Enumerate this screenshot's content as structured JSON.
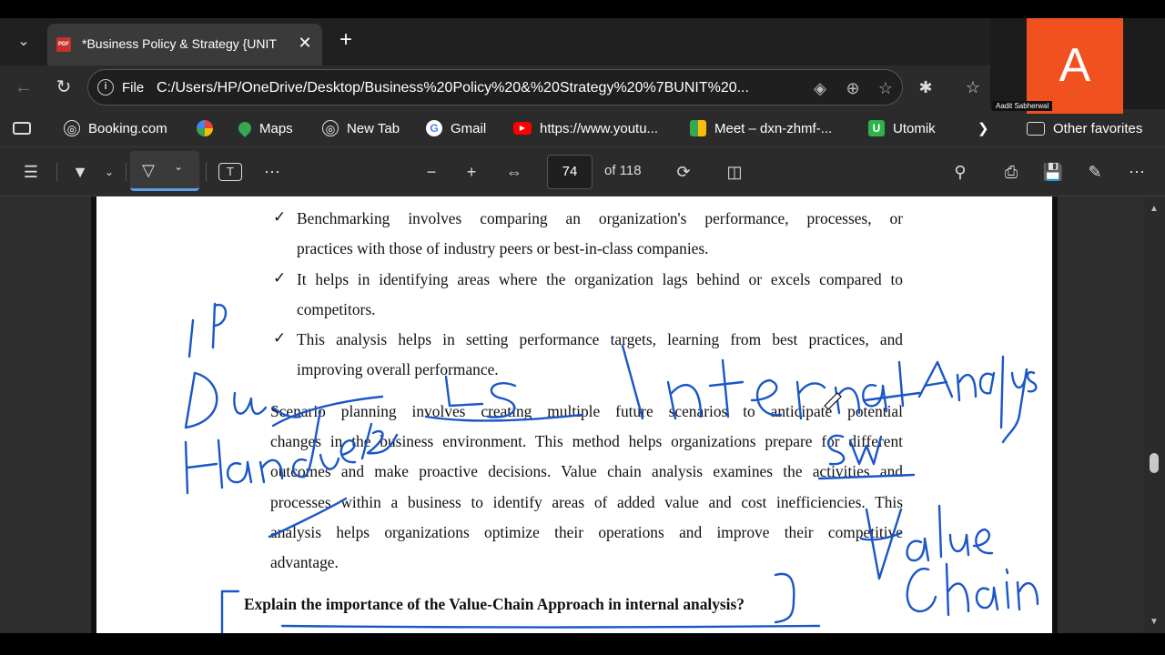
{
  "browser": {
    "tab_title": "*Business Policy & Strategy {UNIT",
    "tab_icon": "pdf-icon",
    "tab_icon_text": "PDF",
    "address_scheme": "File",
    "address_url": "C:/Users/HP/OneDrive/Desktop/Business%20Policy%20&%20Strategy%20%7BUNIT%20..."
  },
  "bookmarks": [
    {
      "label": "Booking.com",
      "icon": "globe-icon"
    },
    {
      "label": "",
      "icon": "google-photos-icon"
    },
    {
      "label": "Maps",
      "icon": "maps-icon"
    },
    {
      "label": "New Tab",
      "icon": "globe-icon"
    },
    {
      "label": "Gmail",
      "icon": "google-icon"
    },
    {
      "label": "https://www.youtu...",
      "icon": "youtube-icon"
    },
    {
      "label": "Meet – dxn-zhmf-...",
      "icon": "meet-icon"
    },
    {
      "label": "Utomik",
      "icon": "utomik-icon"
    }
  ],
  "other_favorites": "Other favorites",
  "pdf_toolbar": {
    "page_number": "74",
    "page_total": "of 118"
  },
  "document": {
    "bullets": [
      [
        "Benchmarking involves comparing an organization's performance, processes, or",
        "practices with those of industry peers or best-in-class companies."
      ],
      [
        "It helps in identifying areas where the organization lags behind or excels compared to",
        "competitors."
      ],
      [
        "This analysis helps in setting performance targets, learning from best practices, and",
        "improving overall performance."
      ]
    ],
    "paragraph": [
      "Scenario planning involves creating multiple future scenarios to anticipate potential",
      "changes in the business environment. This method helps organizations prepare for different",
      "outcomes and make proactive decisions. Value chain analysis examines the activities and",
      "processes within a business to identify areas of added value and cost inefficiencies. This",
      "analysis helps organizations optimize their operations and improve their competitive",
      "advantage."
    ],
    "question": "Explain the importance of the Value-Chain Approach in internal analysis?"
  },
  "meeting": {
    "avatar_letter": "A",
    "participant_name": "Aadit Sabherwal",
    "avatar_color": "#f1501f"
  },
  "colors": {
    "ink": "#1a56c8",
    "accent": "#5aa0e8"
  }
}
